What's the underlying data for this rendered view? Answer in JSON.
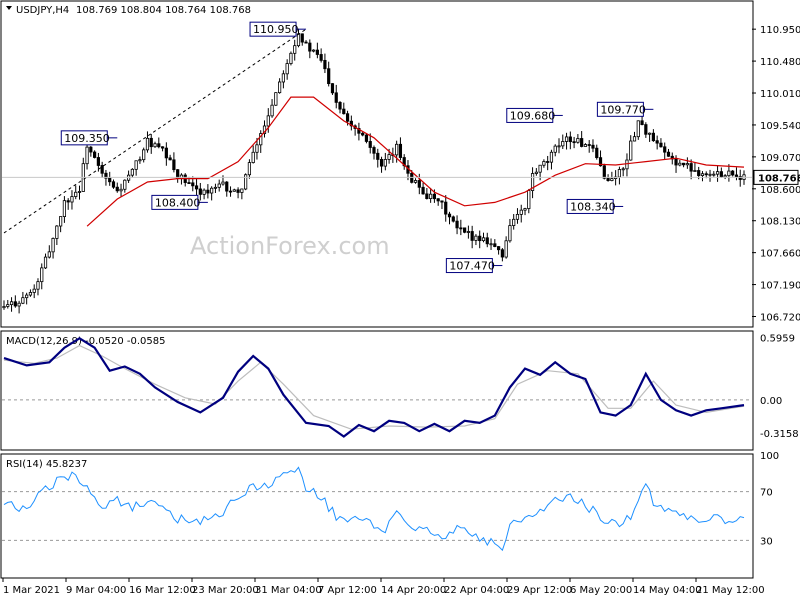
{
  "header": {
    "symbol_tf": "USDJPY,H4",
    "ohlc": "108.769 108.804 108.764 108.768"
  },
  "watermark": "ActionForex.com",
  "colors": {
    "candles": "#000000",
    "ma": "#d00000",
    "macd": "#00007f",
    "signal": "#bdbdbd",
    "rsi": "#1e90ff",
    "price_line": "#c8c8c8",
    "label_box": "#00007f"
  },
  "chart_data": [
    {
      "type": "candlestick",
      "panel": "price",
      "ylim": [
        106.58,
        111.35
      ],
      "y_ticks": [
        "110.950",
        "110.480",
        "110.010",
        "109.540",
        "109.070",
        "108.600",
        "108.130",
        "107.660",
        "107.190",
        "106.720"
      ],
      "current_price": "108.768",
      "current_value": 108.768,
      "x_labels": [
        "1 Mar 2021",
        "9 Mar 04:00",
        "16 Mar 12:00",
        "23 Mar 20:00",
        "31 Mar 04:00",
        "7 Apr 12:00",
        "14 Apr 20:00",
        "22 Apr 04:00",
        "29 Apr 12:00",
        "6 May 20:00",
        "14 May 04:00",
        "21 May 12:00"
      ],
      "close_path": [
        [
          0,
          106.85
        ],
        [
          4,
          106.95
        ],
        [
          8,
          107.1
        ],
        [
          12,
          107.7
        ],
        [
          16,
          108.4
        ],
        [
          20,
          108.6
        ],
        [
          22,
          109.25
        ],
        [
          26,
          108.8
        ],
        [
          30,
          108.55
        ],
        [
          34,
          108.85
        ],
        [
          38,
          109.3
        ],
        [
          42,
          109.15
        ],
        [
          46,
          108.8
        ],
        [
          50,
          108.6
        ],
        [
          54,
          108.55
        ],
        [
          58,
          108.65
        ],
        [
          62,
          108.5
        ],
        [
          66,
          109.1
        ],
        [
          70,
          109.7
        ],
        [
          74,
          110.35
        ],
        [
          78,
          110.9
        ],
        [
          80,
          110.7
        ],
        [
          84,
          110.5
        ],
        [
          88,
          109.9
        ],
        [
          92,
          109.55
        ],
        [
          96,
          109.35
        ],
        [
          100,
          108.9
        ],
        [
          104,
          109.2
        ],
        [
          108,
          108.75
        ],
        [
          112,
          108.5
        ],
        [
          116,
          108.35
        ],
        [
          120,
          108.0
        ],
        [
          124,
          107.9
        ],
        [
          128,
          107.85
        ],
        [
          130,
          107.75
        ],
        [
          132,
          107.6
        ],
        [
          134,
          108.1
        ],
        [
          138,
          108.3
        ],
        [
          140,
          108.8
        ],
        [
          144,
          109.0
        ],
        [
          148,
          109.35
        ],
        [
          152,
          109.3
        ],
        [
          156,
          109.15
        ],
        [
          160,
          108.7
        ],
        [
          164,
          108.9
        ],
        [
          168,
          109.6
        ],
        [
          172,
          109.3
        ],
        [
          176,
          109.05
        ],
        [
          180,
          108.95
        ],
        [
          184,
          108.85
        ],
        [
          188,
          108.8
        ],
        [
          192,
          108.85
        ],
        [
          196,
          108.77
        ]
      ],
      "ma_path": [
        [
          22,
          108.05
        ],
        [
          30,
          108.45
        ],
        [
          38,
          108.7
        ],
        [
          46,
          108.75
        ],
        [
          54,
          108.75
        ],
        [
          62,
          109.0
        ],
        [
          70,
          109.5
        ],
        [
          76,
          109.95
        ],
        [
          82,
          109.95
        ],
        [
          90,
          109.6
        ],
        [
          98,
          109.35
        ],
        [
          106,
          108.95
        ],
        [
          114,
          108.55
        ],
        [
          122,
          108.35
        ],
        [
          130,
          108.4
        ],
        [
          138,
          108.55
        ],
        [
          146,
          108.8
        ],
        [
          154,
          108.97
        ],
        [
          162,
          108.95
        ],
        [
          170,
          109.0
        ],
        [
          178,
          109.05
        ],
        [
          186,
          108.95
        ],
        [
          196,
          108.92
        ]
      ],
      "trendline": [
        [
          0,
          107.95
        ],
        [
          80,
          110.95
        ]
      ],
      "annotations": [
        {
          "label": "110.950",
          "i": 80,
          "y": 110.95,
          "side": "left"
        },
        {
          "label": "109.350",
          "i": 30,
          "y": 109.35,
          "side": "left"
        },
        {
          "label": "109.680",
          "i": 148,
          "y": 109.68,
          "side": "left"
        },
        {
          "label": "109.770",
          "i": 172,
          "y": 109.77,
          "side": "left"
        },
        {
          "label": "108.400",
          "i": 54,
          "y": 108.4,
          "side": "left"
        },
        {
          "label": "107.470",
          "i": 132,
          "y": 107.47,
          "side": "left"
        },
        {
          "label": "108.340",
          "i": 164,
          "y": 108.34,
          "side": "left"
        }
      ]
    },
    {
      "type": "line",
      "panel": "macd",
      "title": "MACD(12,26,9) -0.0520 -0.0585",
      "ylim": [
        -0.47,
        0.65
      ],
      "y_ticks": [
        "0.5959",
        "0.00",
        "-0.3158"
      ],
      "zero_line": 0.0,
      "series": [
        {
          "name": "macd",
          "values": [
            [
              0,
              0.4
            ],
            [
              6,
              0.33
            ],
            [
              12,
              0.36
            ],
            [
              16,
              0.5
            ],
            [
              20,
              0.59
            ],
            [
              24,
              0.5
            ],
            [
              28,
              0.28
            ],
            [
              32,
              0.32
            ],
            [
              36,
              0.25
            ],
            [
              40,
              0.12
            ],
            [
              46,
              -0.02
            ],
            [
              52,
              -0.12
            ],
            [
              58,
              0.02
            ],
            [
              62,
              0.27
            ],
            [
              66,
              0.42
            ],
            [
              70,
              0.3
            ],
            [
              74,
              0.05
            ],
            [
              80,
              -0.22
            ],
            [
              86,
              -0.25
            ],
            [
              90,
              -0.35
            ],
            [
              94,
              -0.24
            ],
            [
              98,
              -0.3
            ],
            [
              102,
              -0.2
            ],
            [
              106,
              -0.22
            ],
            [
              110,
              -0.3
            ],
            [
              114,
              -0.23
            ],
            [
              118,
              -0.3
            ],
            [
              122,
              -0.2
            ],
            [
              126,
              -0.22
            ],
            [
              130,
              -0.15
            ],
            [
              134,
              0.12
            ],
            [
              138,
              0.3
            ],
            [
              142,
              0.24
            ],
            [
              146,
              0.36
            ],
            [
              150,
              0.25
            ],
            [
              154,
              0.2
            ],
            [
              158,
              -0.12
            ],
            [
              162,
              -0.15
            ],
            [
              166,
              -0.05
            ],
            [
              170,
              0.25
            ],
            [
              174,
              0.0
            ],
            [
              178,
              -0.1
            ],
            [
              182,
              -0.15
            ],
            [
              186,
              -0.1
            ],
            [
              190,
              -0.08
            ],
            [
              196,
              -0.05
            ]
          ]
        },
        {
          "name": "signal",
          "values": [
            [
              0,
              0.38
            ],
            [
              8,
              0.35
            ],
            [
              14,
              0.4
            ],
            [
              20,
              0.52
            ],
            [
              26,
              0.42
            ],
            [
              32,
              0.3
            ],
            [
              40,
              0.15
            ],
            [
              48,
              0.02
            ],
            [
              56,
              -0.04
            ],
            [
              62,
              0.18
            ],
            [
              68,
              0.36
            ],
            [
              74,
              0.15
            ],
            [
              82,
              -0.15
            ],
            [
              92,
              -0.28
            ],
            [
              102,
              -0.25
            ],
            [
              112,
              -0.26
            ],
            [
              122,
              -0.25
            ],
            [
              130,
              -0.18
            ],
            [
              136,
              0.15
            ],
            [
              144,
              0.28
            ],
            [
              152,
              0.25
            ],
            [
              160,
              -0.08
            ],
            [
              166,
              -0.08
            ],
            [
              172,
              0.18
            ],
            [
              178,
              -0.05
            ],
            [
              186,
              -0.12
            ],
            [
              196,
              -0.06
            ]
          ]
        }
      ]
    },
    {
      "type": "line",
      "panel": "rsi",
      "title": "RSI(14) 45.8237",
      "ylim": [
        0,
        100
      ],
      "y_ticks": [
        "100",
        "70",
        "30"
      ],
      "levels": [
        70,
        30
      ],
      "values": [
        [
          0,
          60
        ],
        [
          6,
          55
        ],
        [
          10,
          70
        ],
        [
          14,
          78
        ],
        [
          18,
          83
        ],
        [
          22,
          75
        ],
        [
          26,
          58
        ],
        [
          30,
          62
        ],
        [
          34,
          57
        ],
        [
          38,
          62
        ],
        [
          42,
          55
        ],
        [
          46,
          48
        ],
        [
          50,
          44
        ],
        [
          54,
          48
        ],
        [
          58,
          52
        ],
        [
          62,
          68
        ],
        [
          66,
          73
        ],
        [
          70,
          75
        ],
        [
          74,
          82
        ],
        [
          78,
          86
        ],
        [
          80,
          74
        ],
        [
          84,
          65
        ],
        [
          88,
          50
        ],
        [
          92,
          45
        ],
        [
          96,
          48
        ],
        [
          100,
          35
        ],
        [
          104,
          55
        ],
        [
          108,
          42
        ],
        [
          112,
          40
        ],
        [
          116,
          32
        ],
        [
          120,
          40
        ],
        [
          124,
          36
        ],
        [
          128,
          30
        ],
        [
          130,
          27
        ],
        [
          132,
          24
        ],
        [
          134,
          42
        ],
        [
          138,
          50
        ],
        [
          142,
          55
        ],
        [
          146,
          62
        ],
        [
          150,
          70
        ],
        [
          152,
          62
        ],
        [
          156,
          55
        ],
        [
          160,
          45
        ],
        [
          164,
          42
        ],
        [
          168,
          60
        ],
        [
          170,
          75
        ],
        [
          172,
          62
        ],
        [
          176,
          55
        ],
        [
          180,
          52
        ],
        [
          184,
          48
        ],
        [
          188,
          48
        ],
        [
          192,
          45
        ],
        [
          196,
          46
        ]
      ]
    }
  ]
}
